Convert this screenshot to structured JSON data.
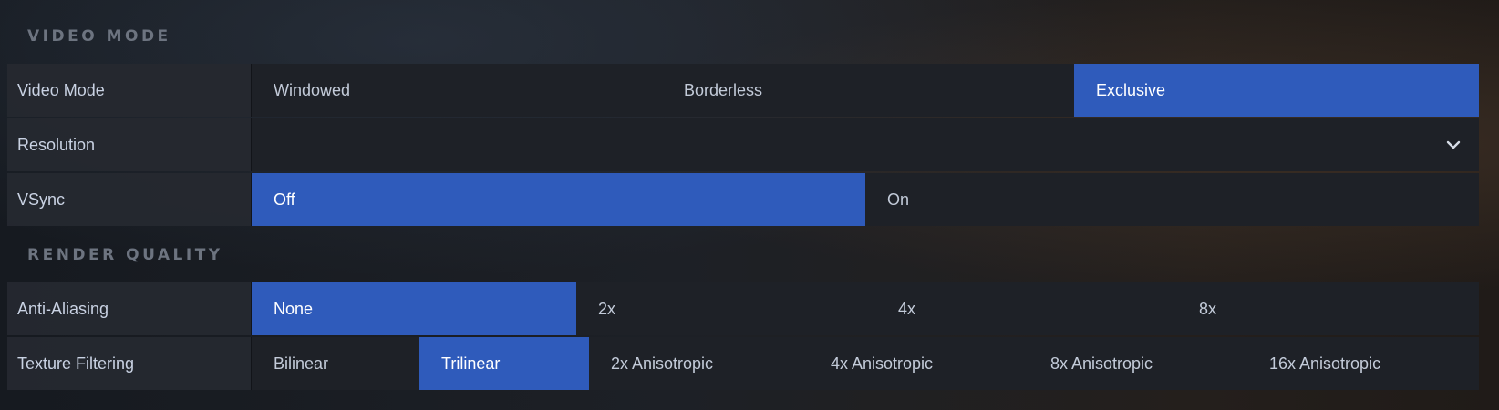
{
  "sections": {
    "video_mode": {
      "title": "VIDEO MODE",
      "video_mode_label": "Video Mode",
      "video_mode_options": [
        "Windowed",
        "Borderless",
        "Exclusive"
      ],
      "video_mode_selected": "Exclusive",
      "resolution_label": "Resolution",
      "resolution_value": "",
      "vsync_label": "VSync",
      "vsync_options": [
        "Off",
        "On"
      ],
      "vsync_selected": "Off"
    },
    "render_quality": {
      "title": "RENDER QUALITY",
      "aa_label": "Anti-Aliasing",
      "aa_options": [
        "None",
        "2x",
        "4x",
        "8x"
      ],
      "aa_selected": "None",
      "tf_label": "Texture Filtering",
      "tf_options": [
        "Bilinear",
        "Trilinear",
        "2x Anisotropic",
        "4x Anisotropic",
        "8x Anisotropic",
        "16x Anisotropic"
      ],
      "tf_selected": "Trilinear"
    }
  },
  "icons": {
    "resolution_dropdown": "chevron-down-icon"
  },
  "colors": {
    "accent": "#2f5bbb",
    "section_title": "#6d7480",
    "row_bg": "#22252c"
  }
}
